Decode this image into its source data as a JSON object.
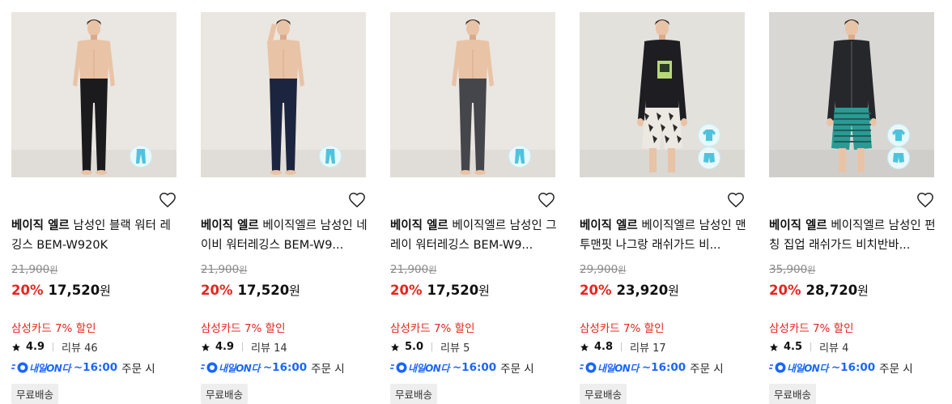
{
  "products": [
    {
      "brand": "베이직 엘르",
      "name": "남성인 블랙 워터 레깅스 BEM-W920K",
      "original_price": "21,900",
      "discount_rate": "20%",
      "sale_price": "17,520",
      "card_discount": "삼성카드 7% 할인",
      "rating": "4.9",
      "review_label": "리뷰 46",
      "delivery_badge": "내일ON다",
      "delivery_time": "~16:00",
      "delivery_suffix": "주문 시",
      "shipping_label": "무료배송",
      "pants_color": "#1b1b1d",
      "top_color": "none",
      "chips": [
        "pants-icon"
      ]
    },
    {
      "brand": "베이직 엘르",
      "name": "베이직엘르 남성인 네이비 워터레깅스 BEM-W9...",
      "original_price": "21,900",
      "discount_rate": "20%",
      "sale_price": "17,520",
      "card_discount": "삼성카드 7% 할인",
      "rating": "4.9",
      "review_label": "리뷰 14",
      "delivery_badge": "내일ON다",
      "delivery_time": "~16:00",
      "delivery_suffix": "주문 시",
      "shipping_label": "무료배송",
      "pants_color": "#1c2540",
      "top_color": "none",
      "chips": [
        "pants-icon"
      ]
    },
    {
      "brand": "베이직 엘르",
      "name": "베이직엘르 남성인 그레이 워터레깅스 BEM-W9...",
      "original_price": "21,900",
      "discount_rate": "20%",
      "sale_price": "17,520",
      "card_discount": "삼성카드 7% 할인",
      "rating": "5.0",
      "review_label": "리뷰 5",
      "delivery_badge": "내일ON다",
      "delivery_time": "~16:00",
      "delivery_suffix": "주문 시",
      "shipping_label": "무료배송",
      "pants_color": "#45464b",
      "top_color": "none",
      "chips": [
        "pants-icon"
      ]
    },
    {
      "brand": "베이직 엘르",
      "name": "베이직엘르 남성인 맨투맨핏 나그랑 래쉬가드 비...",
      "original_price": "29,900",
      "discount_rate": "20%",
      "sale_price": "23,920",
      "card_discount": "삼성카드 7% 할인",
      "rating": "4.8",
      "review_label": "리뷰 17",
      "delivery_badge": "내일ON다",
      "delivery_time": "~16:00",
      "delivery_suffix": "주문 시",
      "shipping_label": "무료배송",
      "pants_color": "#ece8e2",
      "top_color": "#1e1e22",
      "chips": [
        "shirt-icon",
        "shorts-icon"
      ]
    },
    {
      "brand": "베이직 엘르",
      "name": "베이직엘르 남성인 펀칭 집업 래쉬가드 비치반바...",
      "original_price": "35,900",
      "discount_rate": "20%",
      "sale_price": "28,720",
      "card_discount": "삼성카드 7% 할인",
      "rating": "4.5",
      "review_label": "리뷰 4",
      "delivery_badge": "내일ON다",
      "delivery_time": "~16:00",
      "delivery_suffix": "주문 시",
      "shipping_label": "무료배송",
      "pants_color": "#2a9a93",
      "top_color": "#25272b",
      "chips": [
        "shirt-icon",
        "shorts-icon"
      ]
    }
  ],
  "currency_unit": "원",
  "colors": {
    "discount": "#e6251e",
    "delivery_blue": "#1a66ff",
    "strike_gray": "#8a8a8a",
    "chip_cyan": "#4fc3dc"
  }
}
